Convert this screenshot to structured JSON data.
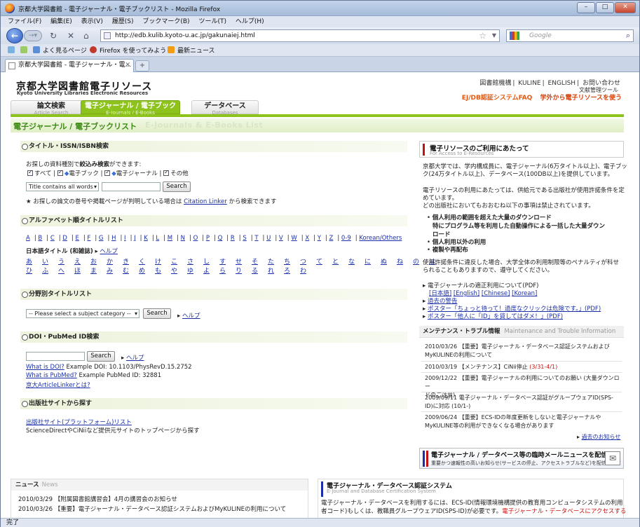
{
  "window": {
    "title": "京都大学図書館 - 電子ジャーナル・電子ブックリスト - Mozilla Firefox",
    "controls": {
      "minimize": "–",
      "maximize": "□",
      "close": "✕"
    }
  },
  "menu": [
    "ファイル(F)",
    "編集(E)",
    "表示(V)",
    "履歴(S)",
    "ブックマーク(B)",
    "ツール(T)",
    "ヘルプ(H)"
  ],
  "nav": {
    "url": "http://edb.kulib.kyoto-u.ac.jp/gakunaiej.html",
    "search_placeholder": "Google"
  },
  "bookmarks": [
    "よく見るページ",
    "Firefox を使ってみよう",
    "最新ニュース"
  ],
  "tab": {
    "label": "京都大学図書館 - 電子ジャーナル・電...",
    "new_tab": "+"
  },
  "status": "完了",
  "page": {
    "site_title": "京都大学図書館電子リソース",
    "site_subtitle": "Kyoto University Libraries Electronic Resources",
    "top_links": [
      "図書館機構",
      "KULINE",
      "ENGLISH",
      "お問い合わせ"
    ],
    "mgmt_link": "文献管理ツール",
    "faq_link": "EJ/DB認証システムFAQ",
    "offcampus_link": "学外から電子リソースを使う",
    "tabs": [
      {
        "label": "論文検索",
        "sub": "Article Search"
      },
      {
        "label": "電子ジャーナル / 電子ブック",
        "sub": "E-Journals / E-Books"
      },
      {
        "label": "データベース",
        "sub": "Databases"
      }
    ],
    "band_title": "電子ジャーナル / 電子ブックリスト",
    "band_title_en": "E-Journals & E-Books List",
    "title_search": {
      "heading": "タイトル・ISSN/ISBN検索",
      "prompt_a": "お探しの資料種別で",
      "prompt_b": "絞込み検索",
      "prompt_c": "ができます:",
      "checks": [
        "すべて",
        "電子ブック",
        "電子ジャーナル",
        "その他"
      ],
      "select": "Title contains all words",
      "button": "Search",
      "note_a": "★ お探しの論文の巻号や掲載ページが判明している場合は",
      "note_link": "Citation Linker",
      "note_b": "から検索できます"
    },
    "alpha": {
      "heading": "アルファベット順タイトルリスト",
      "letters": [
        "A",
        "B",
        "C",
        "D",
        "E",
        "F",
        "G",
        "H",
        "I",
        "J",
        "K",
        "L",
        "M",
        "N",
        "O",
        "P",
        "Q",
        "R",
        "S",
        "T",
        "U",
        "V",
        "W",
        "X",
        "Y",
        "Z",
        "0-9",
        "Korean/Others"
      ],
      "jp_label": "日本語タイトル (和雑誌)",
      "help": "ヘルプ",
      "kana_row1": [
        "あ",
        "い",
        "う",
        "え",
        "お",
        "か",
        "き",
        "く",
        "け",
        "こ",
        "さ",
        "し",
        "す",
        "せ",
        "そ",
        "た",
        "ち",
        "つ",
        "て",
        "と",
        "な",
        "に",
        "ぬ",
        "ね",
        "の",
        "は"
      ],
      "kana_row2": [
        "ひ",
        "ふ",
        "へ",
        "ほ",
        "ま",
        "み",
        "む",
        "め",
        "も",
        "や",
        "ゆ",
        "よ",
        "ら",
        "り",
        "る",
        "れ",
        "ろ",
        "わ"
      ]
    },
    "subject": {
      "heading": "分野別タイトルリスト",
      "select": "-- Please select a subject category --",
      "button": "Search",
      "help": "ヘルプ"
    },
    "doi": {
      "heading": "DOI・PubMed ID検索",
      "button": "Search",
      "help": "ヘルプ",
      "what_doi": "What is DOI?",
      "doi_example": "Example DOI: 10.1103/PhysRevD.15.2752",
      "what_pubmed": "What is PubMed?",
      "pubmed_example": "Example PubMed ID: 32881",
      "linker": "京大ArticleLinkerとは?"
    },
    "publisher": {
      "heading": "出版社サイトから探す",
      "link": "出版社サイト(プラットフォーム)リスト",
      "desc": "ScienceDirectやCiNiiなど提供元サイトのトップページから探す"
    },
    "usage": {
      "title": "電子リソースのご利用にあたって",
      "sub": "For Access to E-Resources",
      "p1a": "京都大学では、学内構成員に、電子ジャーナル(6万タイトル以上)、電子ブッ",
      "p1b": "ク(24万タイトル以上)、データベース(100DB以上)を提供しています。",
      "p2a": "電子リソースの利用にあたっては、供給元である出版社が使用許諾条件を定",
      "p2b": "めています。",
      "p2c": "どの出版社においてもおおむね以下の事項は禁止されています。",
      "bullets": [
        "個人利用の範囲を超えた大量のダウンロード",
        "特にプログラム等を利用した自動操作による一括した大量ダウン",
        "ロード",
        "個人利用以外の利用",
        "複製や再配布"
      ],
      "p3a": "使用許諾条件に違反した場合、大学全体の利用制限等のペナルティが科せ",
      "p3b": "られることもありますので、遵守してください。",
      "links": [
        "電子ジャーナルの適正利用について(PDF)",
        "[日本語]",
        "[English]",
        "[Chinese]",
        "[Korean]",
        "過去の警告",
        "ポスター「ちょっと待って！過度なクリックは危険です。」(PDF)",
        "ポスター「他人に「ID」を貸してはダメ！」(PDF)"
      ]
    },
    "maintenance": {
      "title": "メンテナンス・トラブル情報",
      "title_en": "Maintenance and Trouble Information",
      "items": [
        {
          "a": "2010/03/26 【重要】電子ジャーナル・データベース認証システムおよび",
          "b": "MyKULINEの利用について",
          "red": ""
        },
        {
          "a": "2010/03/19 【メンテナンス】CiNii停止 ",
          "b": "",
          "red": "(3/31-4/1)"
        },
        {
          "a": "2009/12/22 【重要】電子ジャーナルの利用についてのお願い (大量ダウンロー",
          "b": "ドのご注意)",
          "red": ""
        },
        {
          "a": "2009/09/11 電子ジャーナル・データベース認証がグループウェアID(SPS-",
          "b": "ID)に対応 (10/1-)",
          "red": ""
        },
        {
          "a": "2009/06/24 【重要】ECS-IDの年度更新をしないと電子ジャーナルや",
          "b": "MyKULINE等の利用ができなくなる場合があります",
          "red": ""
        }
      ],
      "more": "過去のお知らせ"
    },
    "banner": {
      "title": "電子ジャーナル / データベース等の臨時メールニュースを配信中！",
      "sub": "重要かつ速報性の高いお知らせ(サービスの停止、アクセストラブルなど)を配信します"
    },
    "news": {
      "title": "ニュース",
      "title_en": "News",
      "items": [
        "2010/03/29 【附属図書館講習会】4月の講習会のお知らせ",
        "2010/03/26 【重要】電子ジャーナル・データベース認証システムおよびMyKULINEの利用について"
      ]
    },
    "auth": {
      "title": "電子ジャーナル・データベース認証システム",
      "sub": "E-Journal and Database Certification System",
      "l1": "電子ジャーナル・データベースを利用するには、ECS-ID(情報環境機構提供の教育用コンピュータシステムの利用",
      "l2a": "者コード)もしくは、教職員グループウェアID(SPS-ID)が必要です。",
      "l2b": "電子ジャーナル・データベースにアクセスする"
    }
  }
}
